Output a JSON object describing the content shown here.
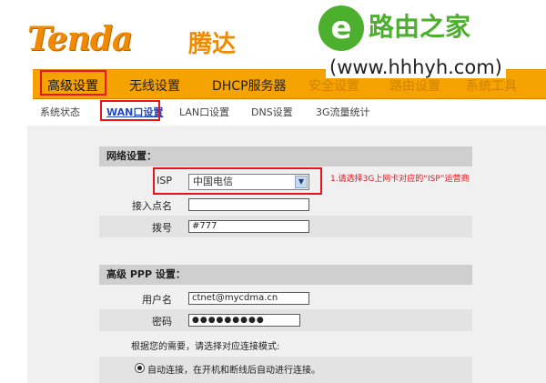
{
  "header": {
    "logo_text": "Tenda",
    "logo_cn": "腾达"
  },
  "watermark": {
    "badge": "e",
    "title": "路由之家",
    "url": "(www.hhhyh.com)"
  },
  "nav": {
    "items": [
      {
        "label": "高级设置"
      },
      {
        "label": "无线设置"
      },
      {
        "label": "DHCP服务器"
      },
      {
        "label": "安全设置"
      },
      {
        "label": "路由设置"
      },
      {
        "label": "系统工具"
      }
    ]
  },
  "subnav": {
    "items": [
      {
        "label": "系统状态"
      },
      {
        "label": "WAN口设置"
      },
      {
        "label": "LAN口设置"
      },
      {
        "label": "DNS设置"
      },
      {
        "label": "3G流量统计"
      }
    ]
  },
  "network_section": {
    "title": "网络设置：",
    "isp_label": "ISP",
    "isp_value": "中国电信",
    "apn_label": "接入点名",
    "apn_value": "",
    "dial_label": "拨号",
    "dial_value": "#777"
  },
  "annotation": "1.请选择3G上网卡对应的“ISP”运营商",
  "ppp_section": {
    "title": "高级 PPP 设置：",
    "username_label": "用户名",
    "username_value": "ctnet@mycdma.cn",
    "password_label": "密码",
    "password_value": "●●●●●●●●●"
  },
  "mode_prompt": "根据您的需要，请选择对应连接模式:",
  "auto_connect_label": "自动连接，在开机和断线后自动进行连接。",
  "colors": {
    "nav_bg": "#f4a300",
    "highlight": "#e8131b",
    "brand": "#f08a00",
    "watermark_green": "#4caf2e"
  }
}
